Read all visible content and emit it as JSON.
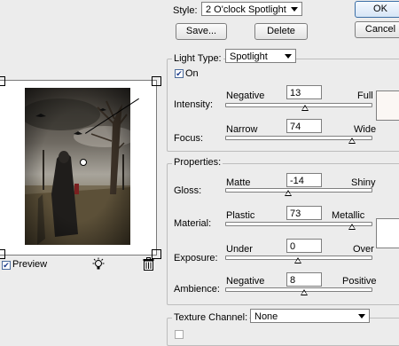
{
  "style": {
    "label": "Style:",
    "value": "2 O'clock Spotlight"
  },
  "buttons": {
    "save": "Save...",
    "delete": "Delete",
    "ok": "OK",
    "cancel": "Cancel"
  },
  "light_type": {
    "label": "Light Type:",
    "value": "Spotlight",
    "on_label": "On",
    "on_checked": true
  },
  "sliders": {
    "intensity": {
      "label": "Intensity:",
      "low": "Negative",
      "high": "Full",
      "value": "13",
      "level": 0.55
    },
    "focus": {
      "label": "Focus:",
      "low": "Narrow",
      "high": "Wide",
      "value": "74",
      "level": 0.87
    },
    "gloss": {
      "label": "Gloss:",
      "low": "Matte",
      "high": "Shiny",
      "value": "-14",
      "level": 0.43
    },
    "material": {
      "label": "Material:",
      "low": "Plastic",
      "high": "Metallic",
      "value": "73",
      "level": 0.87
    },
    "exposure": {
      "label": "Exposure:",
      "low": "Under",
      "high": "Over",
      "value": "0",
      "level": 0.5
    },
    "ambience": {
      "label": "Ambience:",
      "low": "Negative",
      "high": "Positive",
      "value": "8",
      "level": 0.54
    }
  },
  "properties": {
    "label": "Properties:"
  },
  "texture": {
    "label": "Texture Channel:",
    "value": "None"
  },
  "preview": {
    "label": "Preview",
    "checked": true
  },
  "icons": {
    "light": "light-bulb-icon",
    "trash": "trash-icon"
  }
}
